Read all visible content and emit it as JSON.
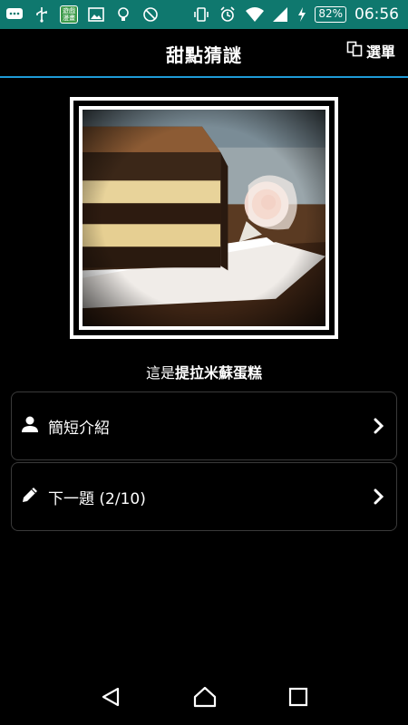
{
  "status_bar": {
    "app_badge_text": "遊戲\n漫畫",
    "battery_percent": "82%",
    "time": "06:56",
    "background": "#0f786e"
  },
  "app_bar": {
    "title": "甜點猜謎",
    "menu_label": "選單",
    "accent": "#1e9bd7"
  },
  "photo": {
    "subject": "tiramisu-cake-photo"
  },
  "caption": {
    "prefix": "這是",
    "answer": "提拉米蘇蛋糕"
  },
  "cards": [
    {
      "icon": "person-icon",
      "label": "簡短介紹"
    },
    {
      "icon": "pencil-icon",
      "label": "下一題 (2/10)"
    }
  ],
  "nav_bar": {
    "buttons": [
      "back-icon",
      "home-icon",
      "recents-icon"
    ]
  }
}
